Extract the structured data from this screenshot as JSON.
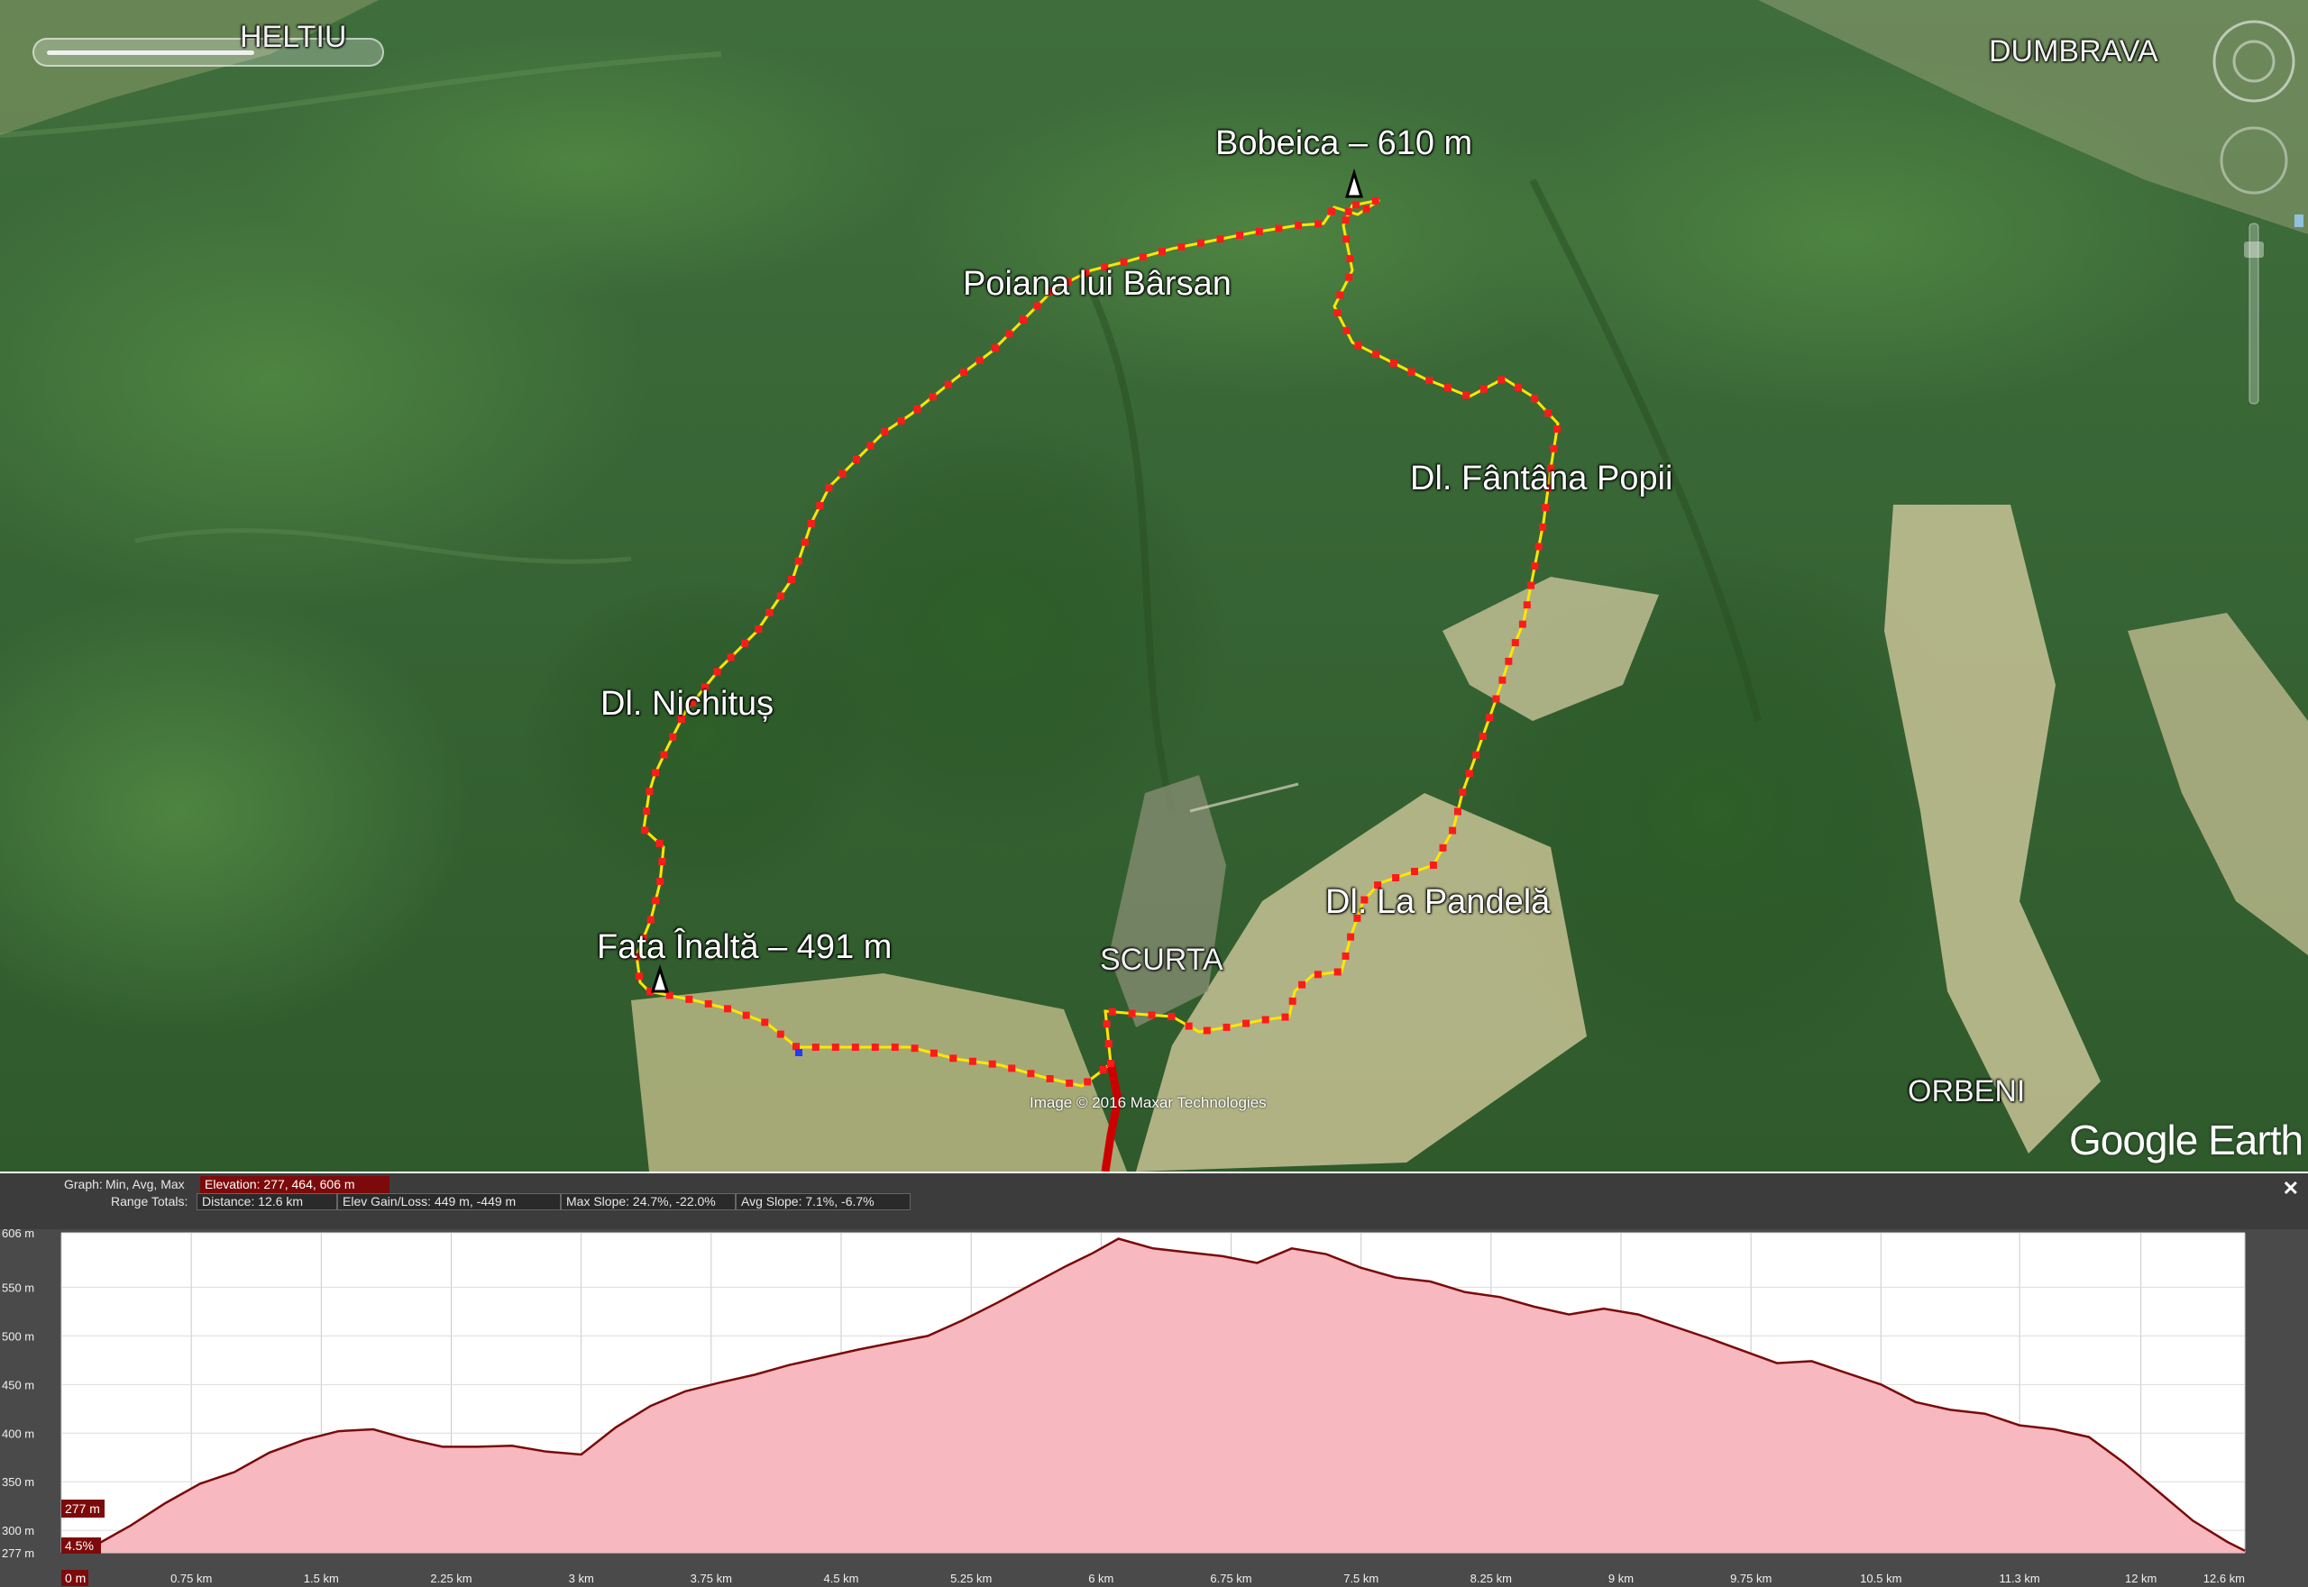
{
  "map": {
    "labels": {
      "heltiu": "HELTIU",
      "dumbrava": "DUMBRAVA",
      "bobeica": "Bobeica – 610 m",
      "poiana": "Poiana lui Bârsan",
      "fantana": "Dl. Fântâna Popii",
      "nichitus": "Dl. Nichituș",
      "pandela": "Dl. La Pandelă",
      "fata": "Fata Înaltă – 491 m",
      "scurta": "SCURTA",
      "orbeni": "ORBENI"
    },
    "attribution": "Image © 2016 Maxar Technologies",
    "logo": "Google Earth",
    "colors": {
      "track": "#ffe600",
      "waypoint": "#ff1a1a",
      "start_track": "#cc0000"
    }
  },
  "profile": {
    "header": {
      "graph_label": "Graph:",
      "graph_opts": "Min, Avg, Max",
      "elevation": "Elevation: 277, 464, 606 m",
      "range_totals": "Range Totals:",
      "distance": "Distance: 12.6 km",
      "elev_gain": "Elev Gain/Loss: 449 m, -449 m",
      "max_slope": "Max Slope: 24.7%, -22.0%",
      "avg_slope": "Avg Slope: 7.1%, -6.7%"
    },
    "cursor": {
      "elev_label": "277 m",
      "slope_label": "4.5%",
      "dist_label": "0 m"
    },
    "close": "✕"
  },
  "chart_data": {
    "type": "area",
    "ylim": [
      277,
      606
    ],
    "xlim": [
      0,
      12.6
    ],
    "y_ticks": [
      "606 m",
      "550 m",
      "500 m",
      "450 m",
      "400 m",
      "350 m",
      "300 m",
      "277 m"
    ],
    "y_tick_values": [
      606,
      550,
      500,
      450,
      400,
      350,
      300,
      277
    ],
    "x_ticks": [
      "0 m",
      "0.75 km",
      "1.5 km",
      "2.25 km",
      "3 km",
      "3.75 km",
      "4.5 km",
      "5.25 km",
      "6 km",
      "6.75 km",
      "7.5 km",
      "8.25 km",
      "9 km",
      "9.75 km",
      "10.5 km",
      "11.3 km",
      "12 km",
      "12.6 km"
    ],
    "x_tick_values": [
      0,
      0.75,
      1.5,
      2.25,
      3,
      3.75,
      4.5,
      5.25,
      6,
      6.75,
      7.5,
      8.25,
      9,
      9.75,
      10.5,
      11.3,
      12,
      12.6
    ],
    "x": [
      0,
      0.2,
      0.4,
      0.6,
      0.8,
      1.0,
      1.2,
      1.4,
      1.6,
      1.8,
      2.0,
      2.2,
      2.4,
      2.6,
      2.8,
      3.0,
      3.2,
      3.4,
      3.6,
      3.8,
      4.0,
      4.2,
      4.4,
      4.6,
      4.8,
      5.0,
      5.2,
      5.4,
      5.6,
      5.8,
      5.95,
      6.1,
      6.3,
      6.5,
      6.7,
      6.9,
      7.1,
      7.3,
      7.5,
      7.7,
      7.9,
      8.1,
      8.3,
      8.5,
      8.7,
      8.9,
      9.1,
      9.3,
      9.5,
      9.7,
      9.9,
      10.1,
      10.3,
      10.5,
      10.7,
      10.9,
      11.1,
      11.3,
      11.5,
      11.7,
      11.9,
      12.1,
      12.3,
      12.5,
      12.6
    ],
    "values": [
      277,
      285,
      305,
      328,
      348,
      360,
      380,
      393,
      402,
      404,
      394,
      386,
      386,
      387,
      381,
      378,
      406,
      428,
      443,
      452,
      460,
      470,
      478,
      486,
      493,
      500,
      516,
      534,
      553,
      572,
      585,
      600,
      590,
      586,
      582,
      575,
      590,
      584,
      570,
      560,
      556,
      545,
      540,
      530,
      522,
      528,
      522,
      510,
      498,
      485,
      472,
      474,
      462,
      450,
      432,
      424,
      420,
      408,
      404,
      396,
      370,
      340,
      310,
      288,
      279
    ],
    "fill_color": "#f7b8bf",
    "line_color": "#7a0a0a"
  }
}
